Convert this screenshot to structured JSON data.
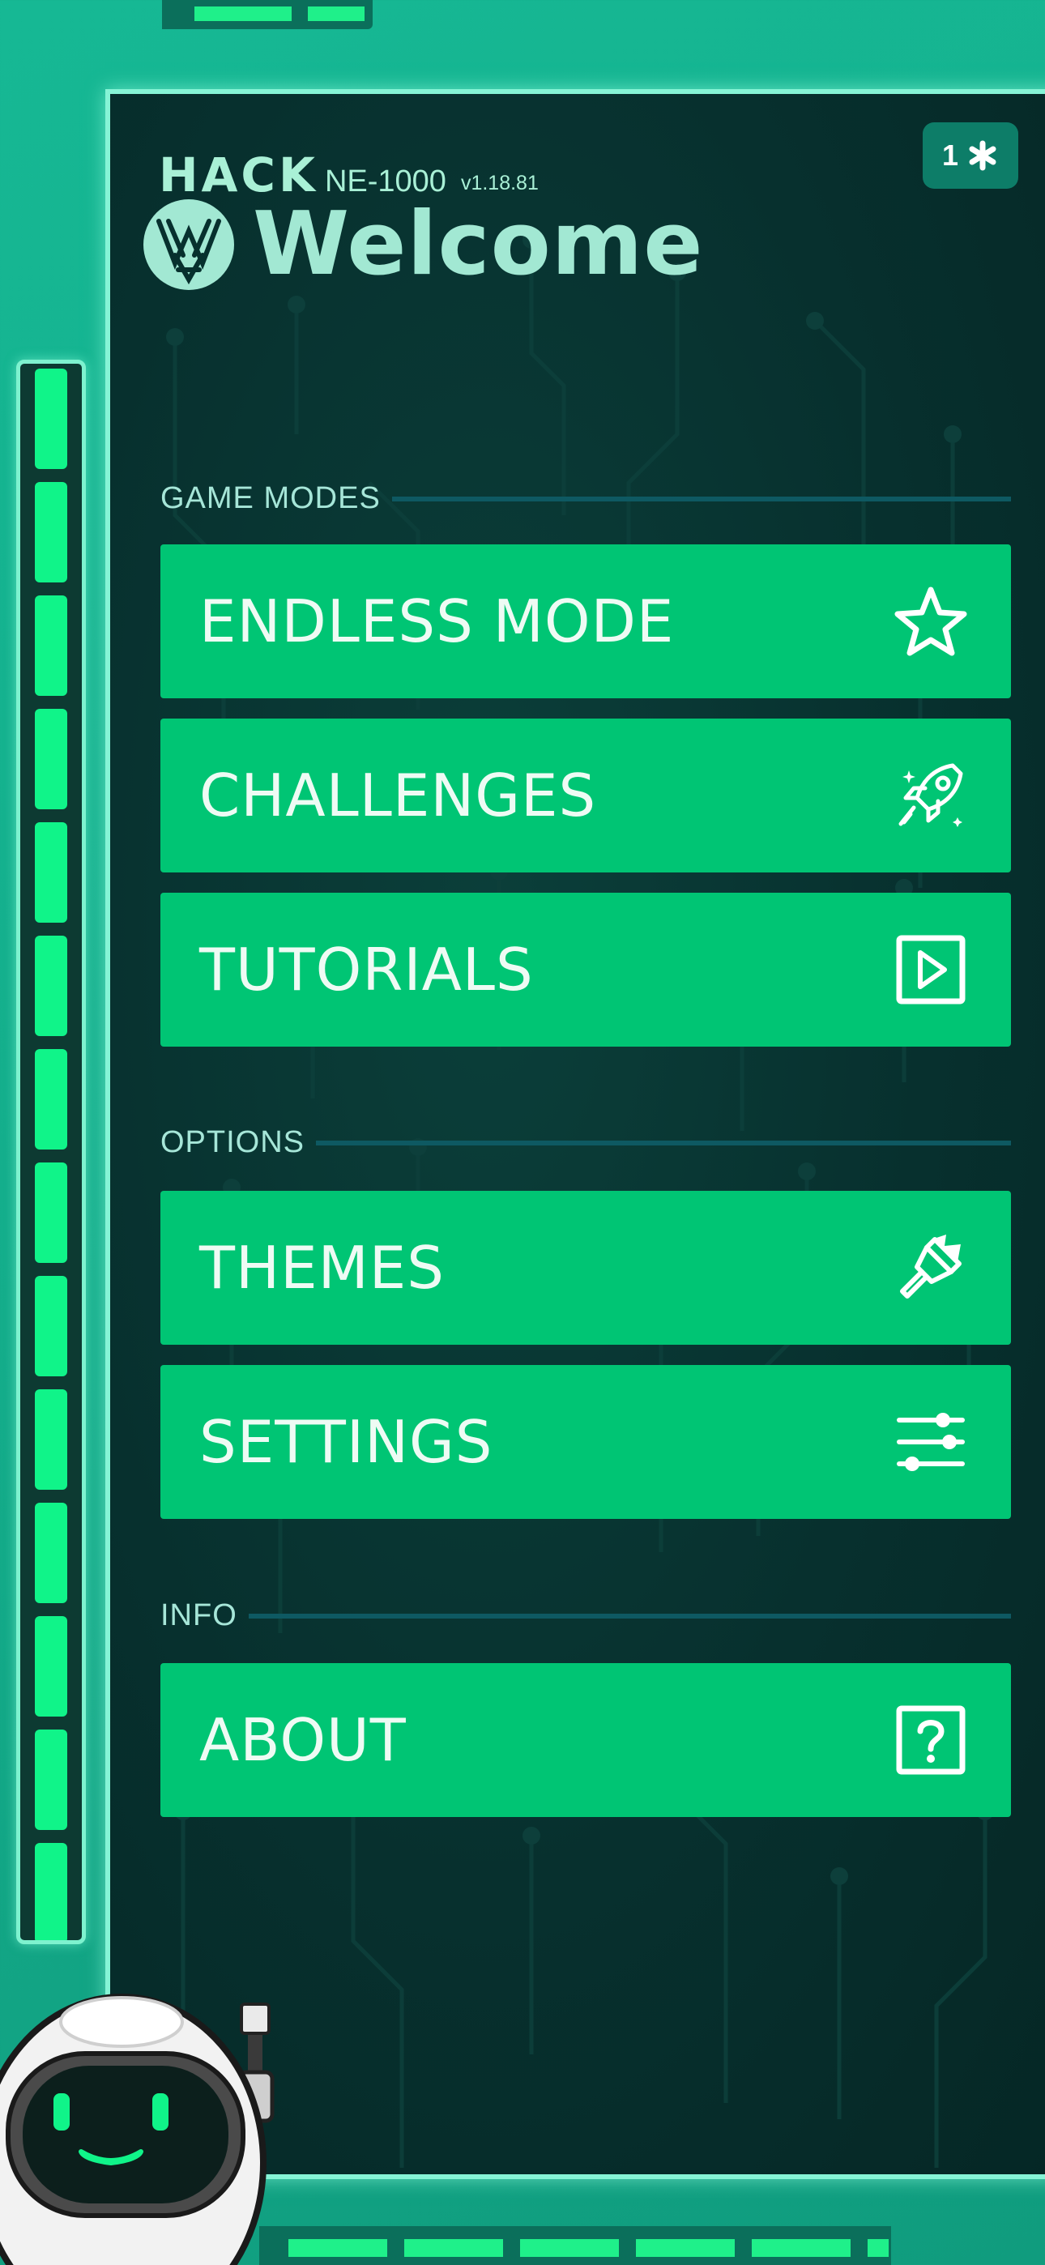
{
  "brand": {
    "logo": "HACK",
    "model": "NE-1000",
    "version": "v1.18.81"
  },
  "badge": {
    "count": "1",
    "icon": "asterisk-icon"
  },
  "header": {
    "title": "Welcome",
    "logo_icon": "wv-emblem-icon"
  },
  "sections": {
    "game_modes": "GAME MODES",
    "options": "OPTIONS",
    "info": "INFO"
  },
  "menu": {
    "endless": {
      "label": "ENDLESS MODE",
      "icon": "star-icon"
    },
    "challenges": {
      "label": "CHALLENGES",
      "icon": "rocket-icon"
    },
    "tutorials": {
      "label": "TUTORIALS",
      "icon": "play-icon"
    },
    "themes": {
      "label": "THEMES",
      "icon": "paintbrush-icon"
    },
    "settings": {
      "label": "SETTINGS",
      "icon": "sliders-icon"
    },
    "about": {
      "label": "ABOUT",
      "icon": "question-icon"
    }
  },
  "colors": {
    "background": "#14ad8b",
    "panel": "#07302e",
    "button": "#00c574",
    "accent": "#10f489",
    "title_text": "#a2e8d3"
  }
}
